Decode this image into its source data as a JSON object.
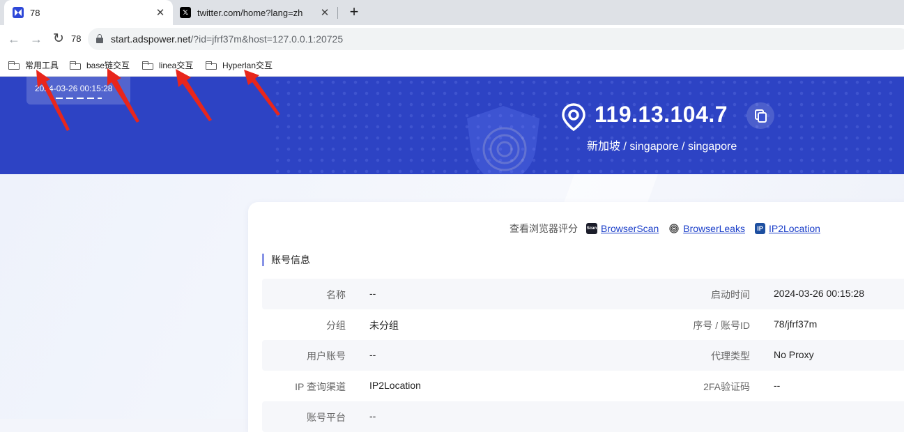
{
  "browser": {
    "tabs": [
      {
        "title": "78",
        "favicon": "adspower-icon",
        "active": true
      },
      {
        "title": "twitter.com/home?lang=zh",
        "favicon": "x-twitter-icon",
        "active": false
      }
    ],
    "tab_count": "78",
    "url_host": "start.adspower.net",
    "url_path": "/?id=jfrf37m&host=127.0.0.1:20725",
    "bookmarks": [
      "常用工具",
      "base链交互",
      "linea交互",
      "Hyperlan交互"
    ]
  },
  "hero": {
    "date": "2024-03-26 00:15:28",
    "ip": "119.13.104.7",
    "location": "新加坡 / singapore / singapore",
    "bg_color": "#2d43c4"
  },
  "links": {
    "label": "查看浏览器评分",
    "items": [
      {
        "name": "BrowserScan",
        "icon": "browserscan-icon"
      },
      {
        "name": "BrowserLeaks",
        "icon": "fingerprint-icon"
      },
      {
        "name": "IP2Location",
        "icon": "ip2location-icon"
      }
    ]
  },
  "account": {
    "title": "账号信息",
    "rows": [
      {
        "k1": "名称",
        "v1": "--",
        "k2": "启动时间",
        "v2": "2024-03-26 00:15:28"
      },
      {
        "k1": "分组",
        "v1": "未分组",
        "k2": "序号 / 账号ID",
        "v2": "78/jfrf37m"
      },
      {
        "k1": "用户账号",
        "v1": "--",
        "k2": "代理类型",
        "v2": "No Proxy"
      },
      {
        "k1": "IP 查询渠道",
        "v1": "IP2Location",
        "k2": "2FA验证码",
        "v2": "--"
      },
      {
        "k1": "账号平台",
        "v1": "--",
        "k2": "",
        "v2": ""
      }
    ]
  },
  "annotation": {
    "arrow_color": "#e8261c"
  }
}
